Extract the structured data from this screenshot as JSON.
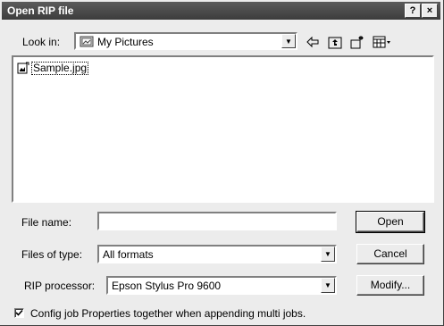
{
  "dialog": {
    "title": "Open RIP file",
    "help_button": "?",
    "close_button": "×"
  },
  "lookin": {
    "label": "Look in:",
    "value": "My Pictures"
  },
  "files": [
    {
      "name": "Sample.jpg"
    }
  ],
  "filename": {
    "label": "File name:",
    "value": "",
    "placeholder": ""
  },
  "filetype": {
    "label": "Files of type:",
    "value": "All formats"
  },
  "rip": {
    "label": "RIP processor:",
    "value": "Epson Stylus Pro 9600"
  },
  "buttons": {
    "open": "Open",
    "cancel": "Cancel",
    "modify": "Modify..."
  },
  "option": {
    "label": "Config job Properties together when appending multi jobs.",
    "checked": true
  }
}
